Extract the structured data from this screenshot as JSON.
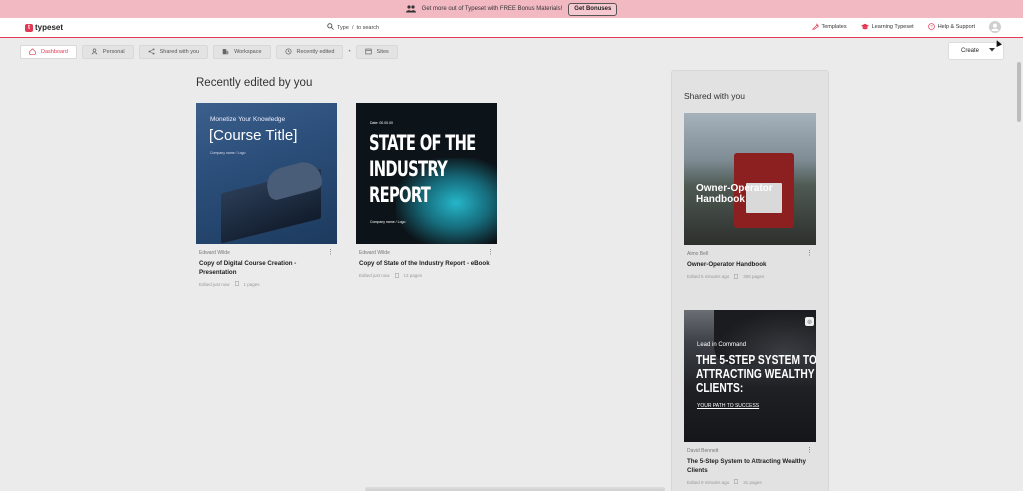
{
  "promo": {
    "text": "Get more out of Typeset with FREE Bonus Materials!",
    "button_label": "Get Bonuses",
    "icon": "users-icon"
  },
  "topnav": {
    "logo_text": "typeset",
    "search_prefix": "Type",
    "search_key": "/",
    "search_suffix": "to search",
    "links": [
      {
        "label": "Templates",
        "icon": "templates-icon"
      },
      {
        "label": "Learning Typeset",
        "icon": "graduation-cap-icon"
      },
      {
        "label": "Help & Support",
        "icon": "help-circle-icon"
      }
    ]
  },
  "tabs": [
    {
      "label": "Dashboard",
      "icon": "home-icon",
      "active": true
    },
    {
      "label": "Personal",
      "icon": "user-icon",
      "active": false
    },
    {
      "label": "Shared with you",
      "icon": "share-icon",
      "active": false
    },
    {
      "label": "Workspace",
      "icon": "building-icon",
      "active": false
    },
    {
      "label": "Recently edited",
      "icon": "history-icon",
      "active": false
    },
    {
      "label": "Sites",
      "icon": "browser-icon",
      "active": false
    }
  ],
  "tab_separator": "•",
  "create_button": "Create",
  "recent": {
    "title": "Recently edited by you",
    "cards": [
      {
        "author": "Edward Wilde",
        "title": "Copy of Digital Course Creation - Presentation",
        "edited": "Edited just now",
        "pages": "1 pages",
        "thumb": {
          "subtitle": "Monetize Your Knowledge",
          "headline": "[Course Title]",
          "small": "Company name / Logo"
        }
      },
      {
        "author": "Edward Wilde",
        "title": "Copy of State of the Industry Report - eBook",
        "edited": "Edited just now",
        "pages": "13 pages",
        "thumb": {
          "date": "Date: 00.00.00",
          "headline": "STATE OF THE INDUSTRY REPORT",
          "small": "Company name / Logo"
        }
      }
    ]
  },
  "shared": {
    "title": "Shared with you",
    "cards": [
      {
        "author": "Aimo Bell",
        "title": "Owner-Operator Handbook",
        "edited": "Edited 5 minutes ago",
        "pages": "305 pages",
        "thumb": {
          "headline": "Owner-Operator Handbook"
        }
      },
      {
        "author": "David Bennett",
        "title": "The 5-Step System to Attracting Wealthy Clients",
        "edited": "Edited 9 minutes ago",
        "pages": "31 pages",
        "thumb": {
          "line1": "Lead in Command",
          "headline": "THE 5-STEP SYSTEM TO ATTRACTING WEALTHY CLIENTS:",
          "sub": "YOUR PATH TO SUCCESS"
        }
      }
    ]
  }
}
